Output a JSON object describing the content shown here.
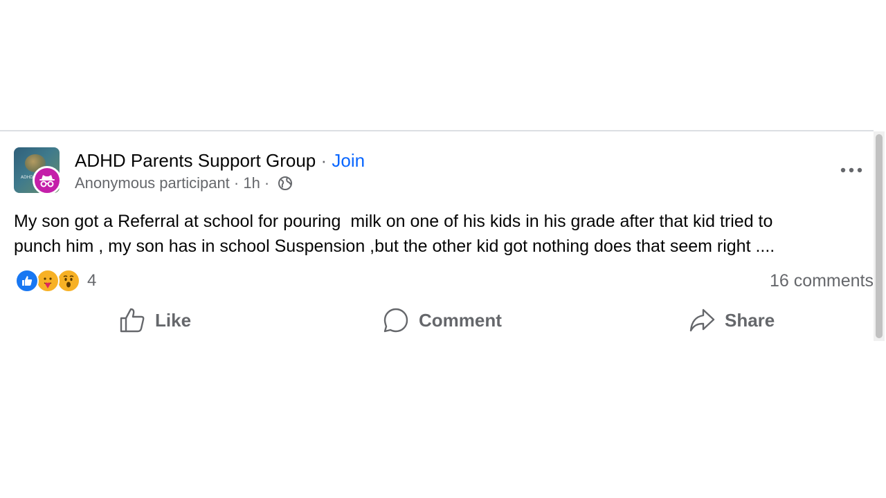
{
  "post": {
    "group_name": "ADHD Parents Support Group",
    "separator": " · ",
    "join_label": "Join",
    "author": "Anonymous participant",
    "time_meta": " · 1h · ",
    "privacy_icon": "globe-icon",
    "more_icon": "more-options-icon",
    "body_line1": "My son got a Referral at school for pouring  milk on one of his kids in his grade after that kid tried to",
    "body_line2": "punch him , my son has in school Suspension ,but the other kid got nothing does that seem right ...."
  },
  "engagement": {
    "reactions": [
      "like-reaction-icon",
      "care-reaction-icon",
      "wow-reaction-icon"
    ],
    "reaction_count": "4",
    "comments": "16 comments"
  },
  "actions": {
    "like_label": "Like",
    "comment_label": "Comment",
    "share_label": "Share"
  },
  "colors": {
    "accent_blue": "#0866ff",
    "anon_badge": "#c41fa9",
    "secondary_text": "#65676b"
  }
}
